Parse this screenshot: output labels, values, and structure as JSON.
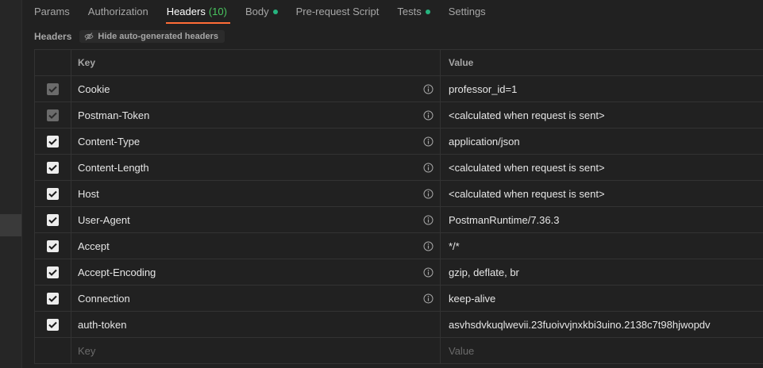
{
  "tabs": [
    {
      "label": "Params",
      "active": false,
      "count": "",
      "dot": false
    },
    {
      "label": "Authorization",
      "active": false,
      "count": "",
      "dot": false
    },
    {
      "label": "Headers",
      "active": true,
      "count": "(10)",
      "dot": false
    },
    {
      "label": "Body",
      "active": false,
      "count": "",
      "dot": true
    },
    {
      "label": "Pre-request Script",
      "active": false,
      "count": "",
      "dot": false
    },
    {
      "label": "Tests",
      "active": false,
      "count": "",
      "dot": true
    },
    {
      "label": "Settings",
      "active": false,
      "count": "",
      "dot": false
    }
  ],
  "section": {
    "title": "Headers",
    "hide_button_label": "Hide auto-generated headers"
  },
  "table": {
    "key_header": "Key",
    "value_header": "Value",
    "rows": [
      {
        "key": "Cookie",
        "value": "professor_id=1",
        "checked": true,
        "disabled": true,
        "info": true
      },
      {
        "key": "Postman-Token",
        "value": "<calculated when request is sent>",
        "checked": true,
        "disabled": true,
        "info": true
      },
      {
        "key": "Content-Type",
        "value": "application/json",
        "checked": true,
        "disabled": false,
        "info": true
      },
      {
        "key": "Content-Length",
        "value": "<calculated when request is sent>",
        "checked": true,
        "disabled": false,
        "info": true
      },
      {
        "key": "Host",
        "value": "<calculated when request is sent>",
        "checked": true,
        "disabled": false,
        "info": true
      },
      {
        "key": "User-Agent",
        "value": "PostmanRuntime/7.36.3",
        "checked": true,
        "disabled": false,
        "info": true
      },
      {
        "key": "Accept",
        "value": "*/*",
        "checked": true,
        "disabled": false,
        "info": true
      },
      {
        "key": "Accept-Encoding",
        "value": "gzip, deflate, br",
        "checked": true,
        "disabled": false,
        "info": true
      },
      {
        "key": "Connection",
        "value": "keep-alive",
        "checked": true,
        "disabled": false,
        "info": true
      },
      {
        "key": "auth-token",
        "value": "asvhsdvkuqlwevii.23fuoivvjnxkbi3uino.2138c7t98hjwopdv",
        "checked": true,
        "disabled": false,
        "info": false
      }
    ],
    "new_row": {
      "key_placeholder": "Key",
      "value_placeholder": "Value"
    }
  },
  "colors": {
    "accent": "#ff6c37",
    "count_green": "#49c55f",
    "dot_green": "#26b47f"
  }
}
